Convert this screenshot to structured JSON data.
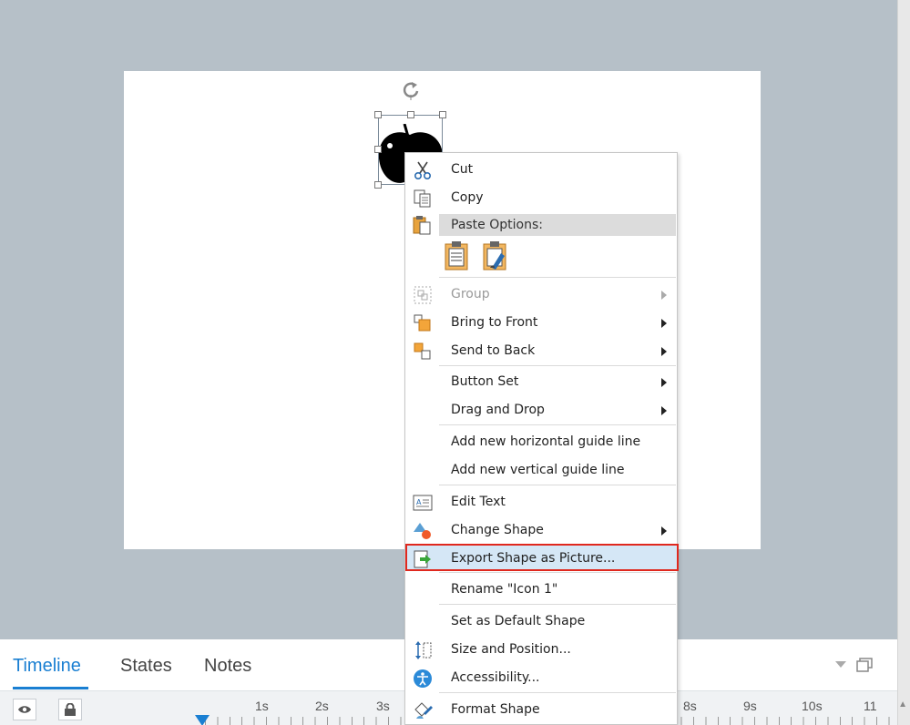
{
  "bottom_panel": {
    "tabs": [
      "Timeline",
      "States",
      "Notes"
    ],
    "ruler_labels": [
      "1s",
      "2s",
      "3s",
      "8s",
      "9s",
      "10s",
      "11"
    ]
  },
  "context_menu": {
    "cut": "Cut",
    "copy": "Copy",
    "paste_options": "Paste Options:",
    "group": "Group",
    "bring_to_front": "Bring to Front",
    "send_to_back": "Send to Back",
    "button_set": "Button Set",
    "drag_and_drop": "Drag and Drop",
    "add_horizontal_guide": "Add new horizontal guide line",
    "add_vertical_guide": "Add new vertical guide line",
    "edit_text": "Edit Text",
    "change_shape": "Change Shape",
    "export_shape": "Export Shape as Picture...",
    "rename": "Rename \"Icon 1\"",
    "set_default": "Set as Default Shape",
    "size_position": "Size and Position...",
    "accessibility": "Accessibility...",
    "format_shape": "Format Shape"
  },
  "colors": {
    "accent": "#1a7fd2",
    "highlight_border": "#e0281e",
    "highlight_bg": "#d5e7f6",
    "workspace": "#b6c0c8"
  }
}
